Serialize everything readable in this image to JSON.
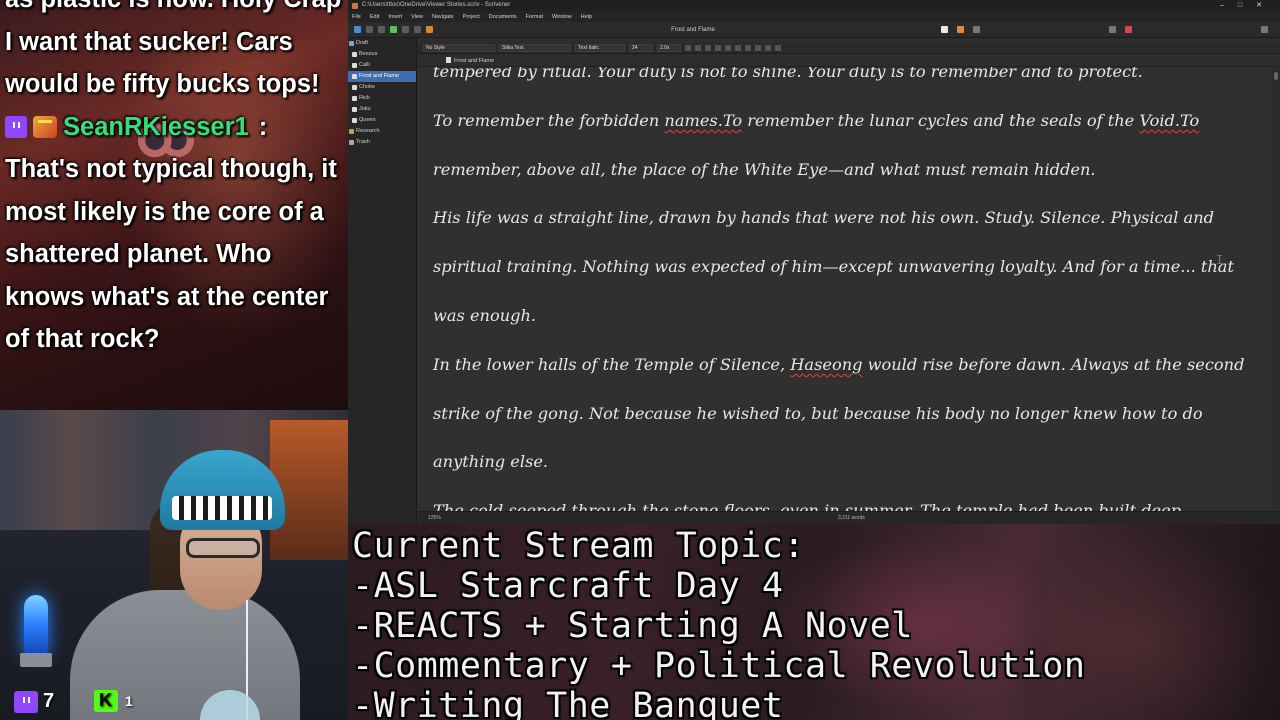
{
  "chat": {
    "messages": [
      {
        "text": "as plastic is now. Holy Crap I want that sucker! Cars would be fifty bucks tops!"
      },
      {
        "username": "SeanRKiesser1",
        "separator": ":",
        "text": "That's not typical though, it most likely is the core of a shattered planet. Who knows what's at the center of that rock?"
      }
    ]
  },
  "counters": {
    "twitch_viewers": "7",
    "kick_viewers": "1"
  },
  "scrivener": {
    "window_title": "C:\\Users\\tttoc\\OneDrive\\Viewer Stories.scriv - Scrivener",
    "window_controls": [
      "–",
      "□",
      "✕"
    ],
    "menu": [
      "File",
      "Edit",
      "Insert",
      "View",
      "Navigate",
      "Project",
      "Documents",
      "Format",
      "Window",
      "Help"
    ],
    "toolbar_title": "Frost and Flame",
    "binder": [
      {
        "label": "Draft",
        "type": "folder"
      },
      {
        "label": "Beezus",
        "type": "doc"
      },
      {
        "label": "Calli",
        "type": "doc"
      },
      {
        "label": "Frost and Flame",
        "type": "doc",
        "selected": true
      },
      {
        "label": "Choke",
        "type": "doc"
      },
      {
        "label": "Rick",
        "type": "doc"
      },
      {
        "label": "Joku",
        "type": "doc"
      },
      {
        "label": "Queen",
        "type": "doc"
      },
      {
        "label": "Research",
        "type": "folder"
      },
      {
        "label": "Trash",
        "type": "trash"
      }
    ],
    "format": {
      "style": "No Style",
      "font": "Sitka Text",
      "typeface": "Text Italic",
      "size": "24",
      "line_spacing": "2.0x"
    },
    "header_title": "Frost and Flame",
    "editor_paragraphs": [
      [
        {
          "t": "tempered by ritual. Your duty is not to shine. Your duty is to remember and to protect."
        }
      ],
      [
        {
          "t": "To remember the forbidden "
        },
        {
          "t": "names.To",
          "spell": true
        },
        {
          "t": " remember the lunar cycles and the seals of the "
        },
        {
          "t": "Void.To",
          "spell": true
        },
        {
          "t": " remember, above all, the place of the White Eye—and what must remain hidden."
        }
      ],
      [
        {
          "t": "His life was a straight line, drawn by hands that were not his own. Study. Silence. Physical and spiritual training. Nothing was expected of him—except unwavering loyalty. And for a time... that was enough."
        }
      ],
      [
        {
          "t": "In the lower halls of the Temple of Silence, "
        },
        {
          "t": "Haseong",
          "spell": true
        },
        {
          "t": " would rise before dawn. Always at the second strike of the gong. Not because he wished to, but because his body no longer knew how to do anything else."
        }
      ],
      [
        {
          "t": "The cold seeped through the stone floors, even in summer. The temple had been built deep"
        }
      ]
    ],
    "footer": {
      "zoom": "125%",
      "word_count": "3,211 words"
    }
  },
  "topic": {
    "lines": [
      "Current Stream Topic:",
      "-ASL Starcraft Day 4",
      "-REACTS + Starting A Novel",
      "-Commentary + Political Revolution",
      "-Writing The Banquet"
    ]
  },
  "colors": {
    "username": "#33e07a",
    "twitch": "#9146ff",
    "kick": "#53fc18",
    "binder_selected": "#3f6db0",
    "editor_bg": "#303030",
    "editor_text": "#e7e7e7"
  }
}
